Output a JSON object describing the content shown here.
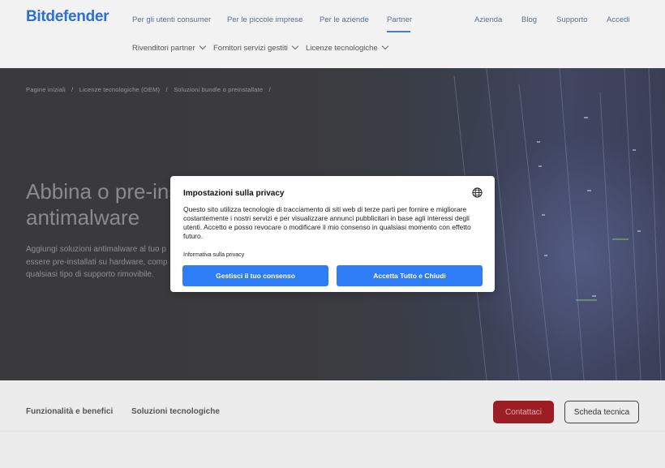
{
  "header": {
    "logo": "Bitdefender",
    "nav": [
      "Per gli utenti consumer",
      "Per le piccole imprese",
      "Per le aziende",
      "Partner"
    ],
    "nav_right": [
      "Azienda",
      "Blog",
      "Supporto",
      "Accedi"
    ],
    "subnav": [
      "Rivenditori partner",
      "Fornitori servizi gestiti",
      "Licenze tecnologiche"
    ],
    "active_nav": "Partner"
  },
  "breadcrumb": [
    "Pagine iniziali",
    "/",
    "Licenze tecnologiche (OEM)",
    "/",
    "Soluzioni bundle o preinstallate",
    "/"
  ],
  "hero": {
    "title_line1": "Abbina o pre-ins",
    "title_line2": "antimalware",
    "text_line1": "Aggiungi soluzioni antimalware al tuo p",
    "text_line2": "essere pre-installati su hardware, comp",
    "text_line3": "qualsiasi tipo di supporto rimovibile."
  },
  "section_nav": {
    "links": [
      "Funzionalità e benefici",
      "Soluzioni tecnologiche"
    ],
    "contact_label": "Contattaci",
    "sheet_label": "Scheda tecnica"
  },
  "privacy_modal": {
    "title": "Impostazioni sulla privacy",
    "body": "Questo sito utilizza tecnologie di tracciamento di siti web di terze parti per fornire e migliorare costantemente i nostri servizi e per visualizzare annunci pubblicitari in base agli interessi degli utenti. Accetto e posso revocare o modificare il mio consenso in qualsiasi momento con effetto futuro.",
    "policy_link": "Informativa sulla privacy",
    "manage_button": "Gestisci il tuo consenso",
    "accept_button": "Accetta Tutto e Chiudi",
    "icon": "globe-icon"
  },
  "colors": {
    "brand": "#2d6fd1",
    "modal_button": "#2e7df6",
    "contact_button": "#9c1e24"
  }
}
